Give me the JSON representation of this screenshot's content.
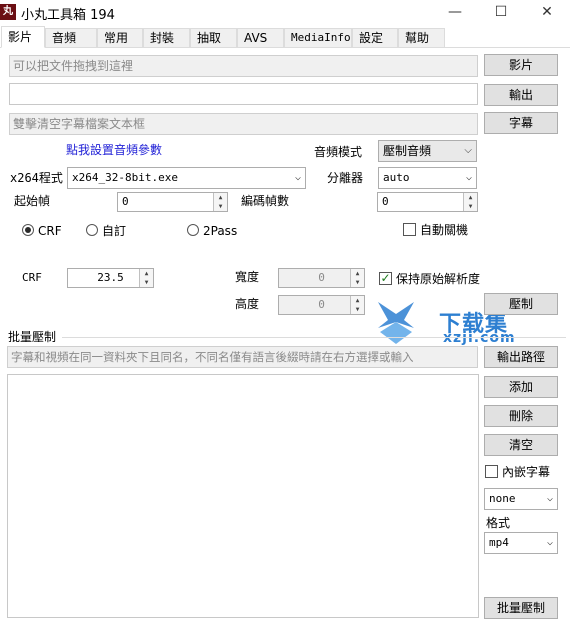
{
  "window": {
    "title": "小丸工具箱 194",
    "icon_text": "丸",
    "minimize": "—",
    "maximize": "☐",
    "close": "✕"
  },
  "tabs": [
    "影片",
    "音頻",
    "常用",
    "封裝",
    "抽取",
    "AVS",
    "MediaInfo",
    "設定",
    "幫助"
  ],
  "video": {
    "video_input_placeholder": "可以把文件拖拽到這裡",
    "output_value": "",
    "subtitle_placeholder": "雙擊清空字幕檔案文本框",
    "video_button": "影片",
    "output_button": "輸出",
    "subtitle_button": "字幕",
    "audio_settings_link": "點我設置音頻參數",
    "audio_mode_label": "音頻模式",
    "audio_mode_value": "壓制音頻",
    "x264_label": "x264程式",
    "x264_value": "x264_32-8bit.exe",
    "splitter_label": "分離器",
    "splitter_value": "auto",
    "start_frame_label": "起始幀",
    "start_frame_value": "0",
    "encode_frames_label": "編碼幀數",
    "encode_frames_value": "0",
    "mode_crf": "CRF",
    "mode_custom": "自訂",
    "mode_2pass": "2Pass",
    "auto_shutdown": "自動關機",
    "crf_label": "CRF",
    "crf_value": "23.5",
    "width_label": "寬度",
    "width_value": "0",
    "height_label": "高度",
    "height_value": "0",
    "keep_resolution": "保持原始解析度",
    "compress_button": "壓制"
  },
  "batch": {
    "section_label": "批量壓制",
    "hint": "字幕和視頻在同一資料夾下且同名，不同名僅有語言後綴時請在右方選擇或輸入",
    "output_path_button": "輸出路徑",
    "add_button": "添加",
    "delete_button": "刪除",
    "clear_button": "清空",
    "embed_subtitle": "內嵌字幕",
    "suffix_value": "none",
    "format_label": "格式",
    "format_value": "mp4",
    "batch_button": "批量壓制"
  },
  "watermark": {
    "text_cn": "下载集",
    "text_url": "xzji.com"
  }
}
